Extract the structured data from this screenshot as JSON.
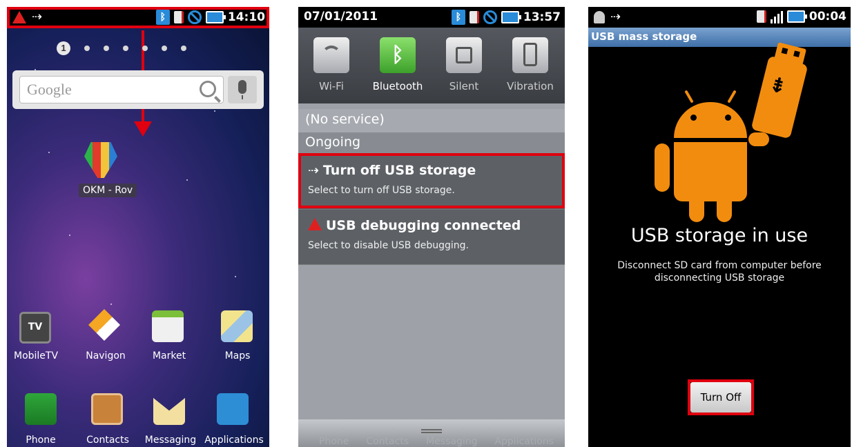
{
  "screen1": {
    "status_time": "14:10",
    "page_indicator": "1",
    "search_placeholder": "Google",
    "widget_label": "OKM - Rov",
    "dock_row1": [
      "MobileTV",
      "Navigon",
      "Market",
      "Maps"
    ],
    "dock_row2": [
      "Phone",
      "Contacts",
      "Messaging",
      "Applications"
    ],
    "tv_text": "TV"
  },
  "screen2": {
    "date": "07/01/2011",
    "status_time": "13:57",
    "quick_settings": [
      "Wi-Fi",
      "Bluetooth",
      "Silent",
      "Vibration"
    ],
    "no_service": "(No service)",
    "ongoing": "Ongoing",
    "notif1_title": "Turn off USB storage",
    "notif1_sub": "Select to turn off USB storage.",
    "notif2_title": "USB debugging connected",
    "notif2_sub": "Select to disable USB debugging.",
    "ghost_dock": [
      "Phone",
      "Contacts",
      "Messaging",
      "Applications"
    ]
  },
  "screen3": {
    "status_time": "00:04",
    "title": "USB mass storage",
    "headline": "USB storage in use",
    "description": "Disconnect SD card from computer before disconnecting USB storage",
    "button": "Turn Off"
  },
  "colors": {
    "highlight": "#e0000f",
    "android_orange": "#f28c0f",
    "bluetooth_blue": "#2a8bd8"
  }
}
